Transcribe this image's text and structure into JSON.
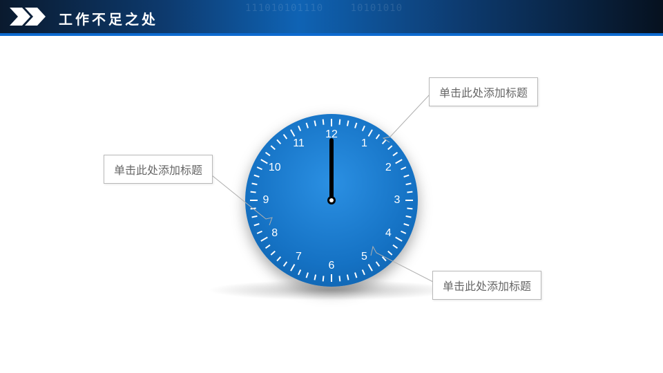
{
  "header": {
    "title": "工作不足之处",
    "binary1": "111010101110",
    "binary2": "10101010"
  },
  "clock": {
    "numbers": [
      "12",
      "1",
      "2",
      "3",
      "4",
      "5",
      "6",
      "7",
      "8",
      "9",
      "10",
      "11"
    ],
    "hourAngle": 0,
    "minuteAngle": 0
  },
  "callouts": {
    "topRight": "单击此处添加标题",
    "left": "单击此处添加标题",
    "bottomRight": "单击此处添加标题"
  }
}
